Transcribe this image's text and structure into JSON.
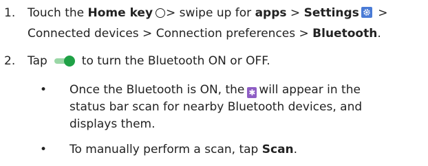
{
  "steps": [
    {
      "number": "1.",
      "line1": {
        "t1": "Touch the ",
        "b1": "Home key",
        "t2": "> swipe up for ",
        "b2": "apps",
        "t3": " > ",
        "b3": "Settings",
        "t4": " >"
      },
      "line2": {
        "t1": "Connected devices > Connection preferences > ",
        "b1": "Bluetooth",
        "t2": "."
      }
    },
    {
      "number": "2.",
      "t1": "Tap",
      "t2": "to turn the Bluetooth ON or OFF."
    }
  ],
  "bullets": [
    {
      "marker": "•",
      "line1a": "Once the Bluetooth is ON, the",
      "line1b": "will appear in the",
      "line2": "status bar scan for nearby Bluetooth devices, and",
      "line3": "displays them."
    },
    {
      "marker": "•",
      "t1": "To manually perform a scan, tap ",
      "b1": "Scan",
      "t2": "."
    }
  ],
  "icons": {
    "home": "home-circle-icon",
    "settings": "gear-icon",
    "toggle": "toggle-on-icon",
    "bluetooth": "bluetooth-icon",
    "bluetooth_glyph": "✱"
  },
  "colors": {
    "settings_icon_bg": "#4a7bd6",
    "toggle_track": "#9ad7a6",
    "toggle_knob": "#1fa146",
    "bluetooth_icon_bg": "#8e5dc4"
  }
}
